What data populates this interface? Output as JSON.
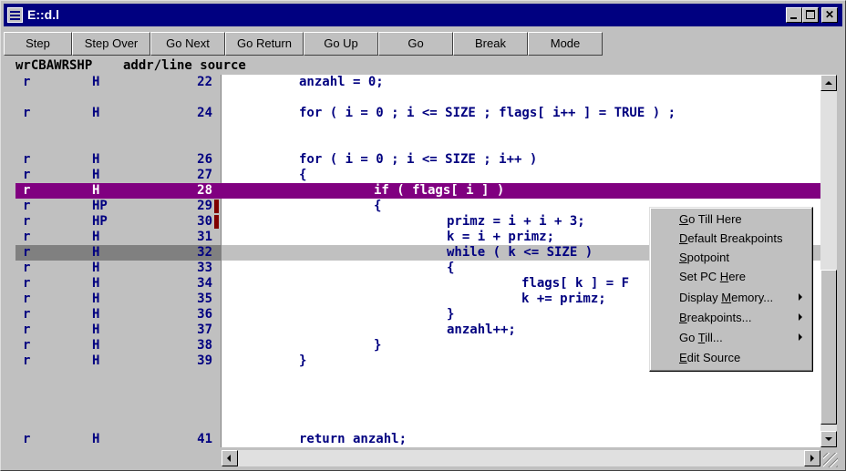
{
  "window": {
    "title": "E::d.l"
  },
  "toolbar": [
    {
      "label": "Step"
    },
    {
      "label": "Step Over"
    },
    {
      "label": "Go Next"
    },
    {
      "label": "Go Return"
    },
    {
      "label": "Go Up"
    },
    {
      "label": "Go"
    },
    {
      "label": "Break"
    },
    {
      "label": "Mode"
    }
  ],
  "header": {
    "text": "wrCBAWRSHP    addr/line source"
  },
  "rows": [
    {
      "mode": "r",
      "flag": "H",
      "line": "22",
      "src": "anzahl = 0;"
    },
    {
      "mode": "r",
      "flag": "H",
      "line": "24",
      "src": "for ( i = 0 ; i <= SIZE ; flags[ i++ ] = TRUE ) ;"
    },
    {
      "mode": "r",
      "flag": "H",
      "line": "26",
      "src": "for ( i = 0 ; i <= SIZE ; i++ )"
    },
    {
      "mode": "r",
      "flag": "H",
      "line": "27",
      "src": "{"
    },
    {
      "mode": "r",
      "flag": "H",
      "line": "28",
      "src": "if ( flags[ i ] )"
    },
    {
      "mode": "r",
      "flag": "HP",
      "line": "29",
      "src": "{"
    },
    {
      "mode": "r",
      "flag": "HP",
      "line": "30",
      "src": "primz = i + i + 3;"
    },
    {
      "mode": "r",
      "flag": "H",
      "line": "31",
      "src": "k = i + primz;"
    },
    {
      "mode": "r",
      "flag": "H",
      "line": "32",
      "src": "while ( k <= SIZE )"
    },
    {
      "mode": "r",
      "flag": "H",
      "line": "33",
      "src": "{"
    },
    {
      "mode": "r",
      "flag": "H",
      "line": "34",
      "src": "flags[ k ] = F"
    },
    {
      "mode": "r",
      "flag": "H",
      "line": "35",
      "src": "k += primz;"
    },
    {
      "mode": "r",
      "flag": "H",
      "line": "36",
      "src": "}"
    },
    {
      "mode": "r",
      "flag": "H",
      "line": "37",
      "src": "anzahl++;"
    },
    {
      "mode": "r",
      "flag": "H",
      "line": "38",
      "src": "}"
    },
    {
      "mode": "r",
      "flag": "H",
      "line": "39",
      "src": "}"
    },
    {
      "mode": "r",
      "flag": "H",
      "line": "41",
      "src": "return anzahl;"
    }
  ],
  "context_menu": [
    {
      "pre": "",
      "key": "G",
      "post": "o Till Here"
    },
    {
      "pre": "",
      "key": "D",
      "post": "efault Breakpoints"
    },
    {
      "pre": "",
      "key": "S",
      "post": "potpoint"
    },
    {
      "pre": "Set PC ",
      "key": "H",
      "post": "ere"
    },
    {
      "pre": "Display ",
      "key": "M",
      "post": "emory..."
    },
    {
      "pre": "",
      "key": "B",
      "post": "reakpoints..."
    },
    {
      "pre": "Go ",
      "key": "T",
      "post": "ill..."
    },
    {
      "pre": "",
      "key": "E",
      "post": "dit Source"
    }
  ],
  "colors": {
    "code": "#000080",
    "selected_line": "#800080",
    "pc_line": "#c0c0c0",
    "breakpoint_mark": "#800000",
    "titlebar": "#000080"
  },
  "icons": [
    "window-menu-icon",
    "minimize-icon",
    "maximize-icon",
    "close-icon",
    "scroll-up-icon",
    "scroll-down-icon",
    "scroll-left-icon",
    "scroll-right-icon",
    "submenu-arrow-icon"
  ]
}
